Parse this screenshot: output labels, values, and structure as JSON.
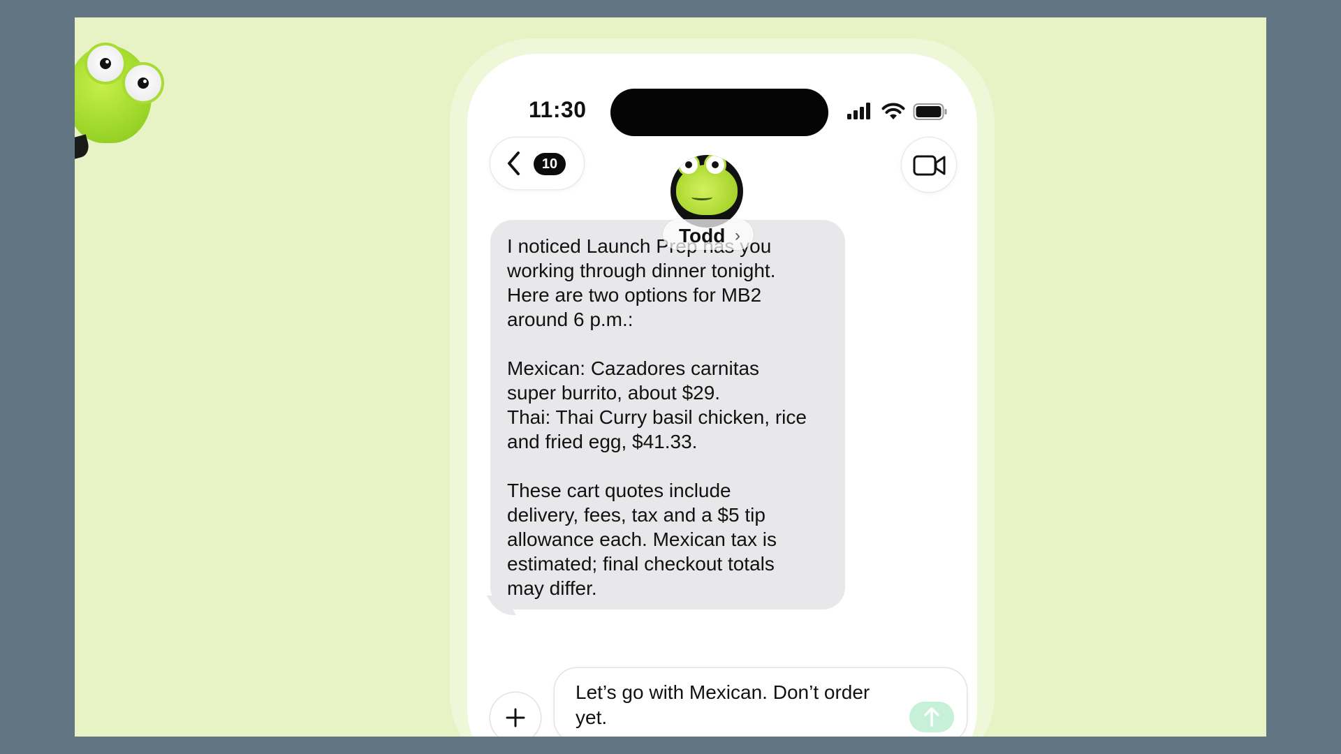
{
  "status_bar": {
    "time": "11:30"
  },
  "nav": {
    "back_badge": "10"
  },
  "contact": {
    "name": "Todd",
    "chevron": "›"
  },
  "message": {
    "paragraphs": [
      "I noticed Launch Prep has you\nworking through dinner tonight.\nHere are two options for MB2\naround 6 p.m.:",
      "Mexican: Cazadores carnitas\nsuper burrito, about $29.\nThai: Thai Curry basil chicken, rice\nand fried egg, $41.33.",
      "These cart quotes include\ndelivery, fees, tax and a $5 tip\nallowance each. Mexican tax is\nestimated; final checkout totals\nmay differ."
    ]
  },
  "composer": {
    "text": "Let’s go with Mexican. Don’t order yet."
  },
  "colors": {
    "background": "#627582",
    "stage": "#e7f3c5",
    "bubble": "#e8e8ea",
    "send_button": "#c6f0d8",
    "frog_green": "#a6d62c"
  },
  "icons": [
    "back-chevron-icon",
    "video-camera-icon",
    "plus-icon",
    "send-arrow-icon",
    "signal-icon",
    "wifi-icon",
    "battery-icon"
  ]
}
